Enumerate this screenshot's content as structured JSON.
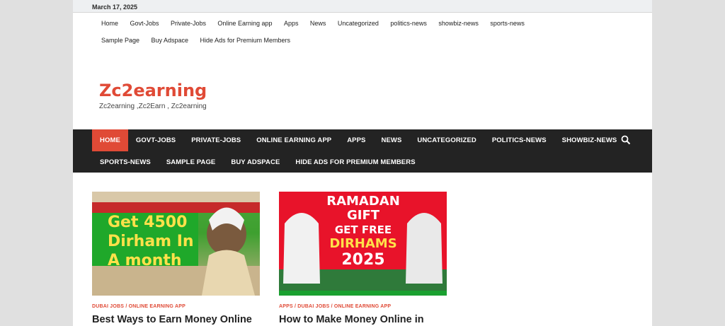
{
  "topbar": {
    "date": "March 17, 2025"
  },
  "top_nav": {
    "items": [
      "Home",
      "Govt-Jobs",
      "Private-Jobs",
      "Online Earning app",
      "Apps",
      "News",
      "Uncategorized",
      "politics-news",
      "showbiz-news",
      "sports-news",
      "Sample Page",
      "Buy Adspace",
      "Hide Ads for Premium Members"
    ]
  },
  "brand": {
    "title": "Zc2earning",
    "tagline": "Zc2earning ,Zc2Earn , Zc2earning"
  },
  "main_nav": {
    "row1": [
      "HOME",
      "GOVT-JOBS",
      "PRIVATE-JOBS",
      "ONLINE EARNING APP",
      "APPS",
      "NEWS",
      "UNCATEGORIZED",
      "POLITICS-NEWS",
      "SHOWBIZ-NEWS"
    ],
    "row2": [
      "SPORTS-NEWS",
      "SAMPLE PAGE",
      "BUY ADSPACE",
      "HIDE ADS FOR PREMIUM MEMBERS"
    ],
    "search_icon": "search-icon"
  },
  "posts": [
    {
      "thumb_lines": [
        "Get 4500",
        "Dirham In",
        "A month"
      ],
      "categories": "DUBAI JOBS / ONLINE EARNING APP",
      "title": "Best Ways to Earn Money Online in"
    },
    {
      "thumb_lines": [
        "RAMADAN",
        "GIFT",
        "GET FREE",
        "DIRHAMS",
        "2025"
      ],
      "categories": "APPS / DUBAI JOBS / ONLINE EARNING APP",
      "title": "How to Make Money Online in"
    }
  ],
  "colors": {
    "accent": "#e04a36",
    "nav_bg": "#232323"
  }
}
